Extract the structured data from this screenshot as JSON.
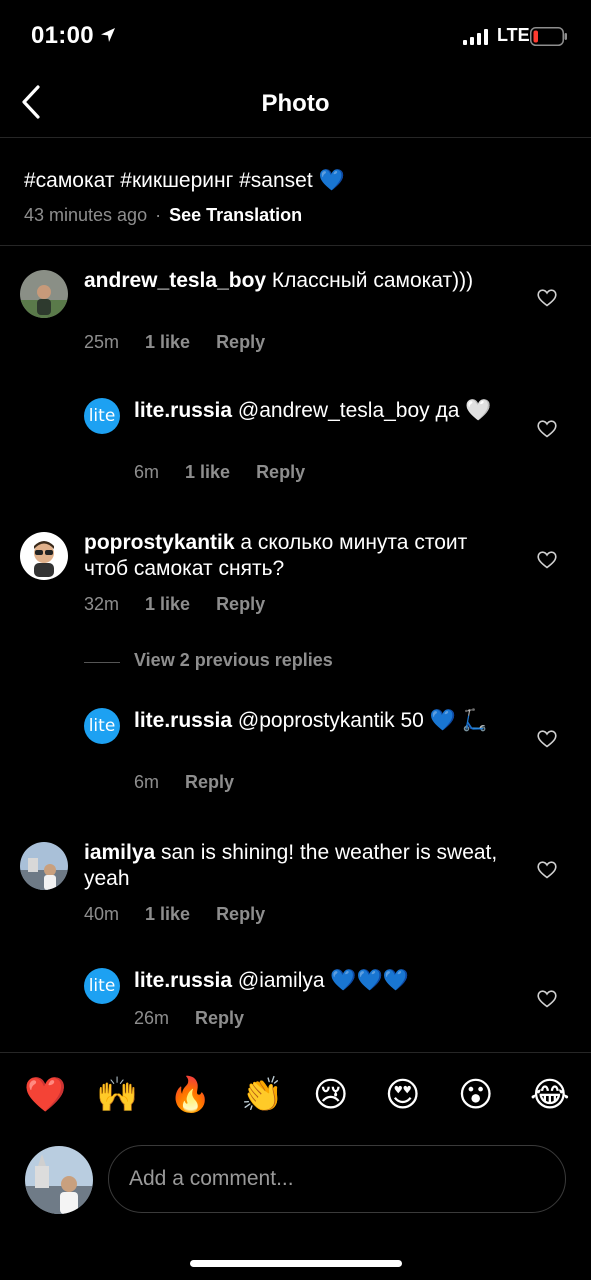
{
  "status": {
    "time": "01:00",
    "network": "LTE"
  },
  "nav": {
    "title": "Photo"
  },
  "caption": {
    "text": "#самокат #кикшеринг #sanset 💙",
    "time": "43 minutes ago",
    "separator": "·",
    "see_translation": "See Translation"
  },
  "comments": [
    {
      "username": "andrew_tesla_boy",
      "text": " Классный самокат)))",
      "time": "25m",
      "likes": "1 like",
      "reply": "Reply"
    },
    {
      "username": "lite.russia",
      "avatar_text": "lite",
      "text": " @andrew_tesla_boy да 🤍",
      "time": "6m",
      "likes": "1 like",
      "reply": "Reply"
    },
    {
      "username": "poprostykantik",
      "text": " а сколько минута стоит чтоб самокат снять?",
      "time": "32m",
      "likes": "1 like",
      "reply": "Reply"
    },
    {
      "username": "lite.russia",
      "avatar_text": "lite",
      "text": " @poprostykantik 50 💙 🛴",
      "time": "6m",
      "reply": "Reply"
    },
    {
      "username": "iamilya",
      "text": " san is shining! the weather is sweat, yeah",
      "time": "40m",
      "likes": "1 like",
      "reply": "Reply"
    },
    {
      "username": "lite.russia",
      "avatar_text": "lite",
      "text": " @iamilya 💙💙💙",
      "time": "26m",
      "reply": "Reply"
    }
  ],
  "view_previous": "View 2 previous replies",
  "emojis": [
    "❤️",
    "🙌",
    "🔥",
    "👏",
    "😢",
    "😍",
    "😮",
    "😂"
  ],
  "input": {
    "placeholder": "Add a comment..."
  },
  "colors": {
    "background": "#000000",
    "secondary_text": "#8e8e8e",
    "lite_avatar": "#1da1f2",
    "heart_fill": "#4a90e2",
    "battery_low": "#ff3b30"
  }
}
